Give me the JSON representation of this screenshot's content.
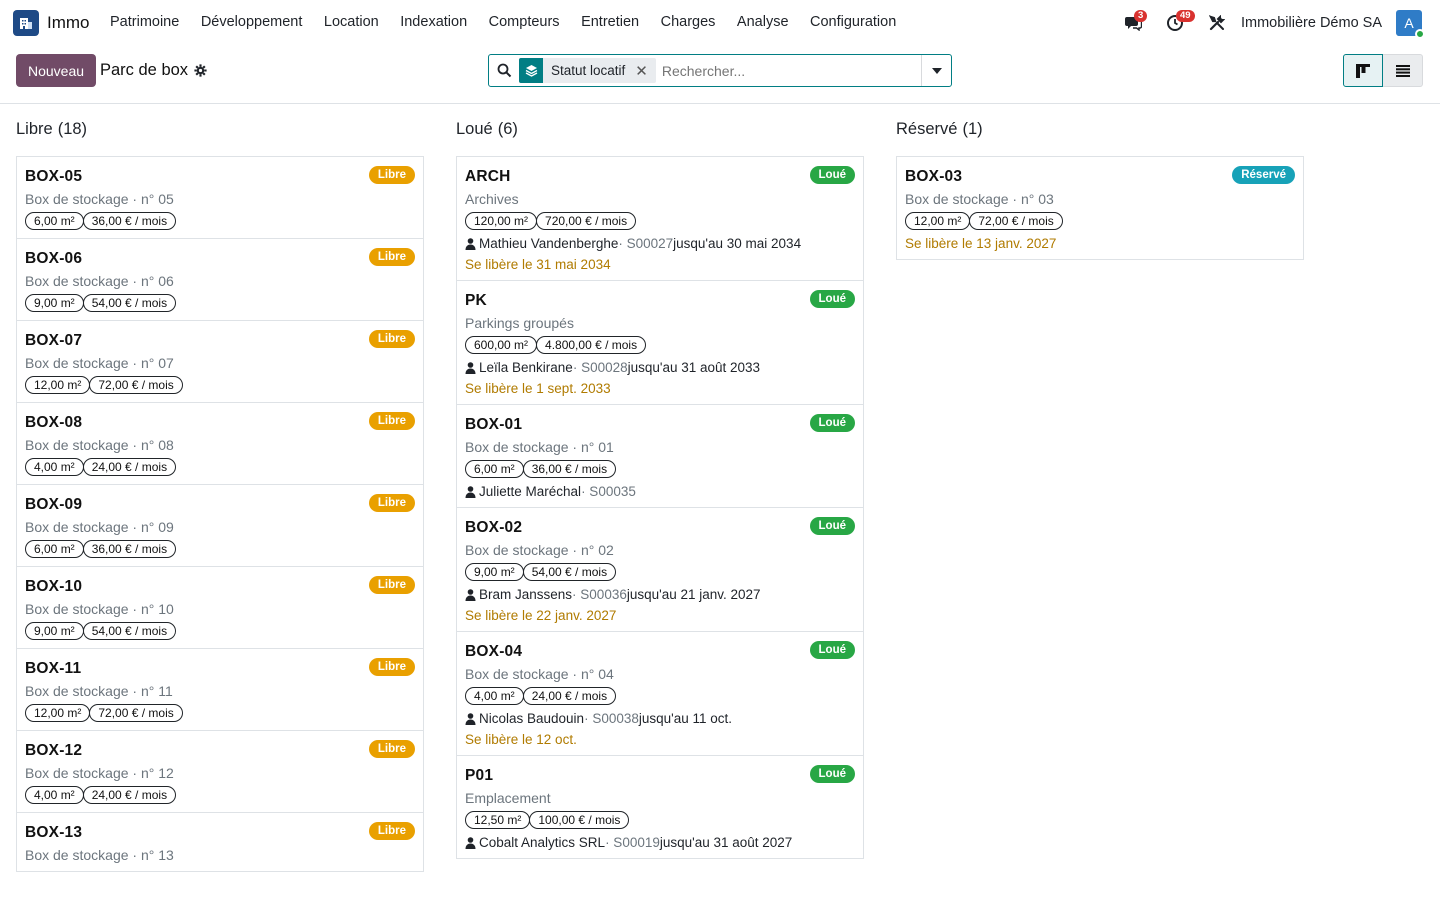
{
  "app": {
    "name": "Immo",
    "icon": "building-icon"
  },
  "menu": [
    "Patrimoine",
    "Développement",
    "Location",
    "Indexation",
    "Compteurs",
    "Entretien",
    "Charges",
    "Analyse",
    "Configuration"
  ],
  "systray": {
    "messages_count": "3",
    "activities_count": "49",
    "company": "Immobilière Démo SA",
    "avatar_letter": "A"
  },
  "control": {
    "new_label": "Nouveau",
    "breadcrumb": "Parc de box",
    "facet": "Statut locatif",
    "search_placeholder": "Rechercher..."
  },
  "columns": [
    {
      "title": "Libre",
      "count": "(18)",
      "cards": [
        {
          "name": "BOX-05",
          "badge": "Libre",
          "sub": "Box de stockage · n° 05",
          "tags": [
            "6,00 m²",
            "36,00 € / mois"
          ]
        },
        {
          "name": "BOX-06",
          "badge": "Libre",
          "sub": "Box de stockage · n° 06",
          "tags": [
            "9,00 m²",
            "54,00 € / mois"
          ]
        },
        {
          "name": "BOX-07",
          "badge": "Libre",
          "sub": "Box de stockage · n° 07",
          "tags": [
            "12,00 m²",
            "72,00 € / mois"
          ]
        },
        {
          "name": "BOX-08",
          "badge": "Libre",
          "sub": "Box de stockage · n° 08",
          "tags": [
            "4,00 m²",
            "24,00 € / mois"
          ]
        },
        {
          "name": "BOX-09",
          "badge": "Libre",
          "sub": "Box de stockage · n° 09",
          "tags": [
            "6,00 m²",
            "36,00 € / mois"
          ]
        },
        {
          "name": "BOX-10",
          "badge": "Libre",
          "sub": "Box de stockage · n° 10",
          "tags": [
            "9,00 m²",
            "54,00 € / mois"
          ]
        },
        {
          "name": "BOX-11",
          "badge": "Libre",
          "sub": "Box de stockage · n° 11",
          "tags": [
            "12,00 m²",
            "72,00 € / mois"
          ]
        },
        {
          "name": "BOX-12",
          "badge": "Libre",
          "sub": "Box de stockage · n° 12",
          "tags": [
            "4,00 m²",
            "24,00 € / mois"
          ]
        },
        {
          "name": "BOX-13",
          "badge": "Libre",
          "sub": "Box de stockage · n° 13",
          "tags": []
        }
      ]
    },
    {
      "title": "Loué",
      "count": "(6)",
      "cards": [
        {
          "name": "ARCH",
          "badge": "Loué",
          "sub": "Archives",
          "tags": [
            "120,00 m²",
            "720,00 € / mois"
          ],
          "tenant": "Mathieu Vandenberghe",
          "ref": " · S00027",
          "until": " jusqu'au 30 mai 2034",
          "release": "Se libère le 31 mai 2034"
        },
        {
          "name": "PK",
          "badge": "Loué",
          "sub": "Parkings groupés",
          "tags": [
            "600,00 m²",
            "4.800,00 € / mois"
          ],
          "tenant": "Leïla Benkirane",
          "ref": " · S00028",
          "until": " jusqu'au 31 août 2033",
          "release": "Se libère le 1 sept. 2033"
        },
        {
          "name": "BOX-01",
          "badge": "Loué",
          "sub": "Box de stockage · n° 01",
          "tags": [
            "6,00 m²",
            "36,00 € / mois"
          ],
          "tenant": "Juliette Maréchal",
          "ref": " · S00035",
          "until": "",
          "release": ""
        },
        {
          "name": "BOX-02",
          "badge": "Loué",
          "sub": "Box de stockage · n° 02",
          "tags": [
            "9,00 m²",
            "54,00 € / mois"
          ],
          "tenant": "Bram Janssens",
          "ref": " · S00036",
          "until": " jusqu'au 21 janv. 2027",
          "release": "Se libère le 22 janv. 2027"
        },
        {
          "name": "BOX-04",
          "badge": "Loué",
          "sub": "Box de stockage · n° 04",
          "tags": [
            "4,00 m²",
            "24,00 € / mois"
          ],
          "tenant": "Nicolas Baudouin",
          "ref": " · S00038",
          "until": " jusqu'au 11 oct.",
          "release": "Se libère le 12 oct."
        },
        {
          "name": "P01",
          "badge": "Loué",
          "sub": "Emplacement",
          "tags": [
            "12,50 m²",
            "100,00 € / mois"
          ],
          "tenant": "Cobalt Analytics SRL",
          "ref": " · S00019",
          "until": " jusqu'au 31 août 2027",
          "release": ""
        }
      ]
    },
    {
      "title": "Réservé",
      "count": "(1)",
      "cards": [
        {
          "name": "BOX-03",
          "badge": "Réservé",
          "sub": "Box de stockage · n° 03",
          "tags": [
            "12,00 m²",
            "72,00 € / mois"
          ],
          "release": "Se libère le 13 janv. 2027"
        }
      ]
    }
  ],
  "colors": {
    "primary": "#714b67",
    "teal": "#017e84",
    "libre": "#e9a000",
    "loue": "#28a745",
    "reserve": "#17a2b8",
    "release": "#b07b00"
  }
}
